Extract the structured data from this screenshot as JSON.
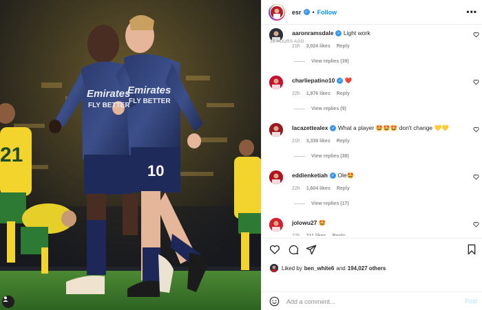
{
  "post": {
    "author": "esr",
    "follow_label": "Follow",
    "more_label": "•••"
  },
  "photo": {
    "player_left": {
      "shirt_text_1": "Emirates",
      "shirt_text_2": "FLY BETTER"
    },
    "player_right": {
      "shirt_text_1": "Emirates",
      "shirt_text_2": "FLY BETTER",
      "number": "10"
    },
    "opponent_number": "21",
    "icon": "user-tag-icon"
  },
  "comments": [
    {
      "user": "aaronramsdale",
      "verified": true,
      "text": "Light work",
      "time": "21h",
      "likes": "3,024 likes",
      "reply": "Reply",
      "view_replies": "View replies (39)",
      "avatar_color": "#2b2f3a"
    },
    {
      "user": "charliepatino10",
      "verified": true,
      "text": "❤️",
      "time": "22h",
      "likes": "1,976 likes",
      "reply": "Reply",
      "view_replies": "View replies (9)",
      "avatar_color": "#c8102e"
    },
    {
      "user": "lacazettealex",
      "verified": true,
      "text": "What a player 🤩🤩🤩 don't change 💛💛",
      "time": "21h",
      "likes": "3,338 likes",
      "reply": "Reply",
      "view_replies": "View replies (38)",
      "avatar_color": "#9c1b22"
    },
    {
      "user": "eddienketiah",
      "verified": true,
      "text": "Ole🤩",
      "time": "22h",
      "likes": "1,604 likes",
      "reply": "Reply",
      "view_replies": "View replies (17)",
      "avatar_color": "#b3121d"
    },
    {
      "user": "jolowu27",
      "verified": false,
      "text": "🤩",
      "time": "22h",
      "likes": "211 likes",
      "reply": "Reply",
      "view_replies": "",
      "avatar_color": "#d4202c"
    }
  ],
  "actions": {
    "icons": [
      "heart-icon",
      "comment-icon",
      "share-icon",
      "bookmark-icon"
    ],
    "liked_prefix": "Liked by",
    "liked_user": "ben_white6",
    "liked_and": "and",
    "liked_count": "194,027 others",
    "time_ago": "22 HOURS AGO"
  },
  "add_comment": {
    "placeholder": "Add a comment...",
    "post_label": "Post",
    "icon": "emoji-icon"
  },
  "colors": {
    "accent": "#0095f6",
    "verified": "#3897f0",
    "muted": "#8e8e8e",
    "arsenal_red": "#c8102e",
    "pitch": "#3e7a2c"
  }
}
